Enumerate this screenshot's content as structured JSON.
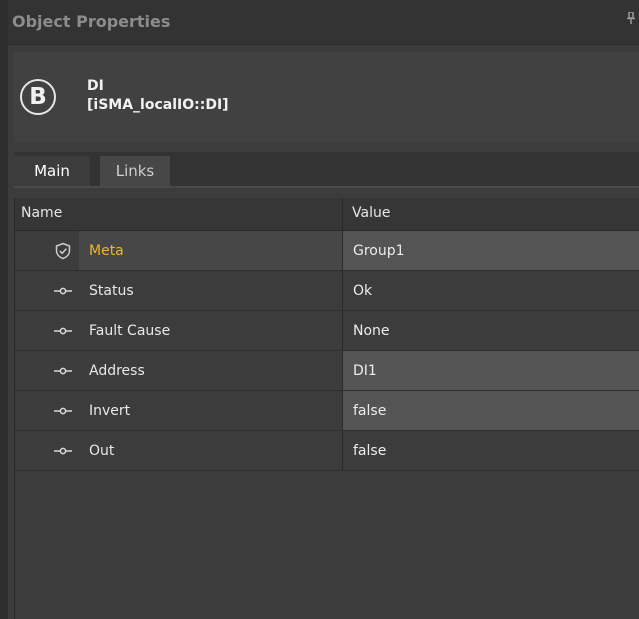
{
  "panel": {
    "title": "Object Properties",
    "pin_glyph": "q"
  },
  "object": {
    "badge_letter": "B",
    "name_line1": "DI",
    "name_line2": "[iSMA_localIO::DI]"
  },
  "tabs": [
    {
      "label": "Main",
      "active": true
    },
    {
      "label": "Links",
      "active": false
    }
  ],
  "grid": {
    "columns": {
      "name": "Name",
      "value": "Value"
    },
    "rows": [
      {
        "icon": "shield-check-icon",
        "name": "Meta",
        "value": "Group1"
      },
      {
        "icon": "slot-icon",
        "name": "Status",
        "value": "Ok"
      },
      {
        "icon": "slot-icon",
        "name": "Fault Cause",
        "value": "None"
      },
      {
        "icon": "slot-icon",
        "name": "Address",
        "value": "DI1"
      },
      {
        "icon": "slot-icon",
        "name": "Invert",
        "value": "false"
      },
      {
        "icon": "slot-icon",
        "name": "Out",
        "value": "false"
      }
    ]
  },
  "colors": {
    "meta_label": "#f0b429",
    "background": "#3c3c3c"
  }
}
